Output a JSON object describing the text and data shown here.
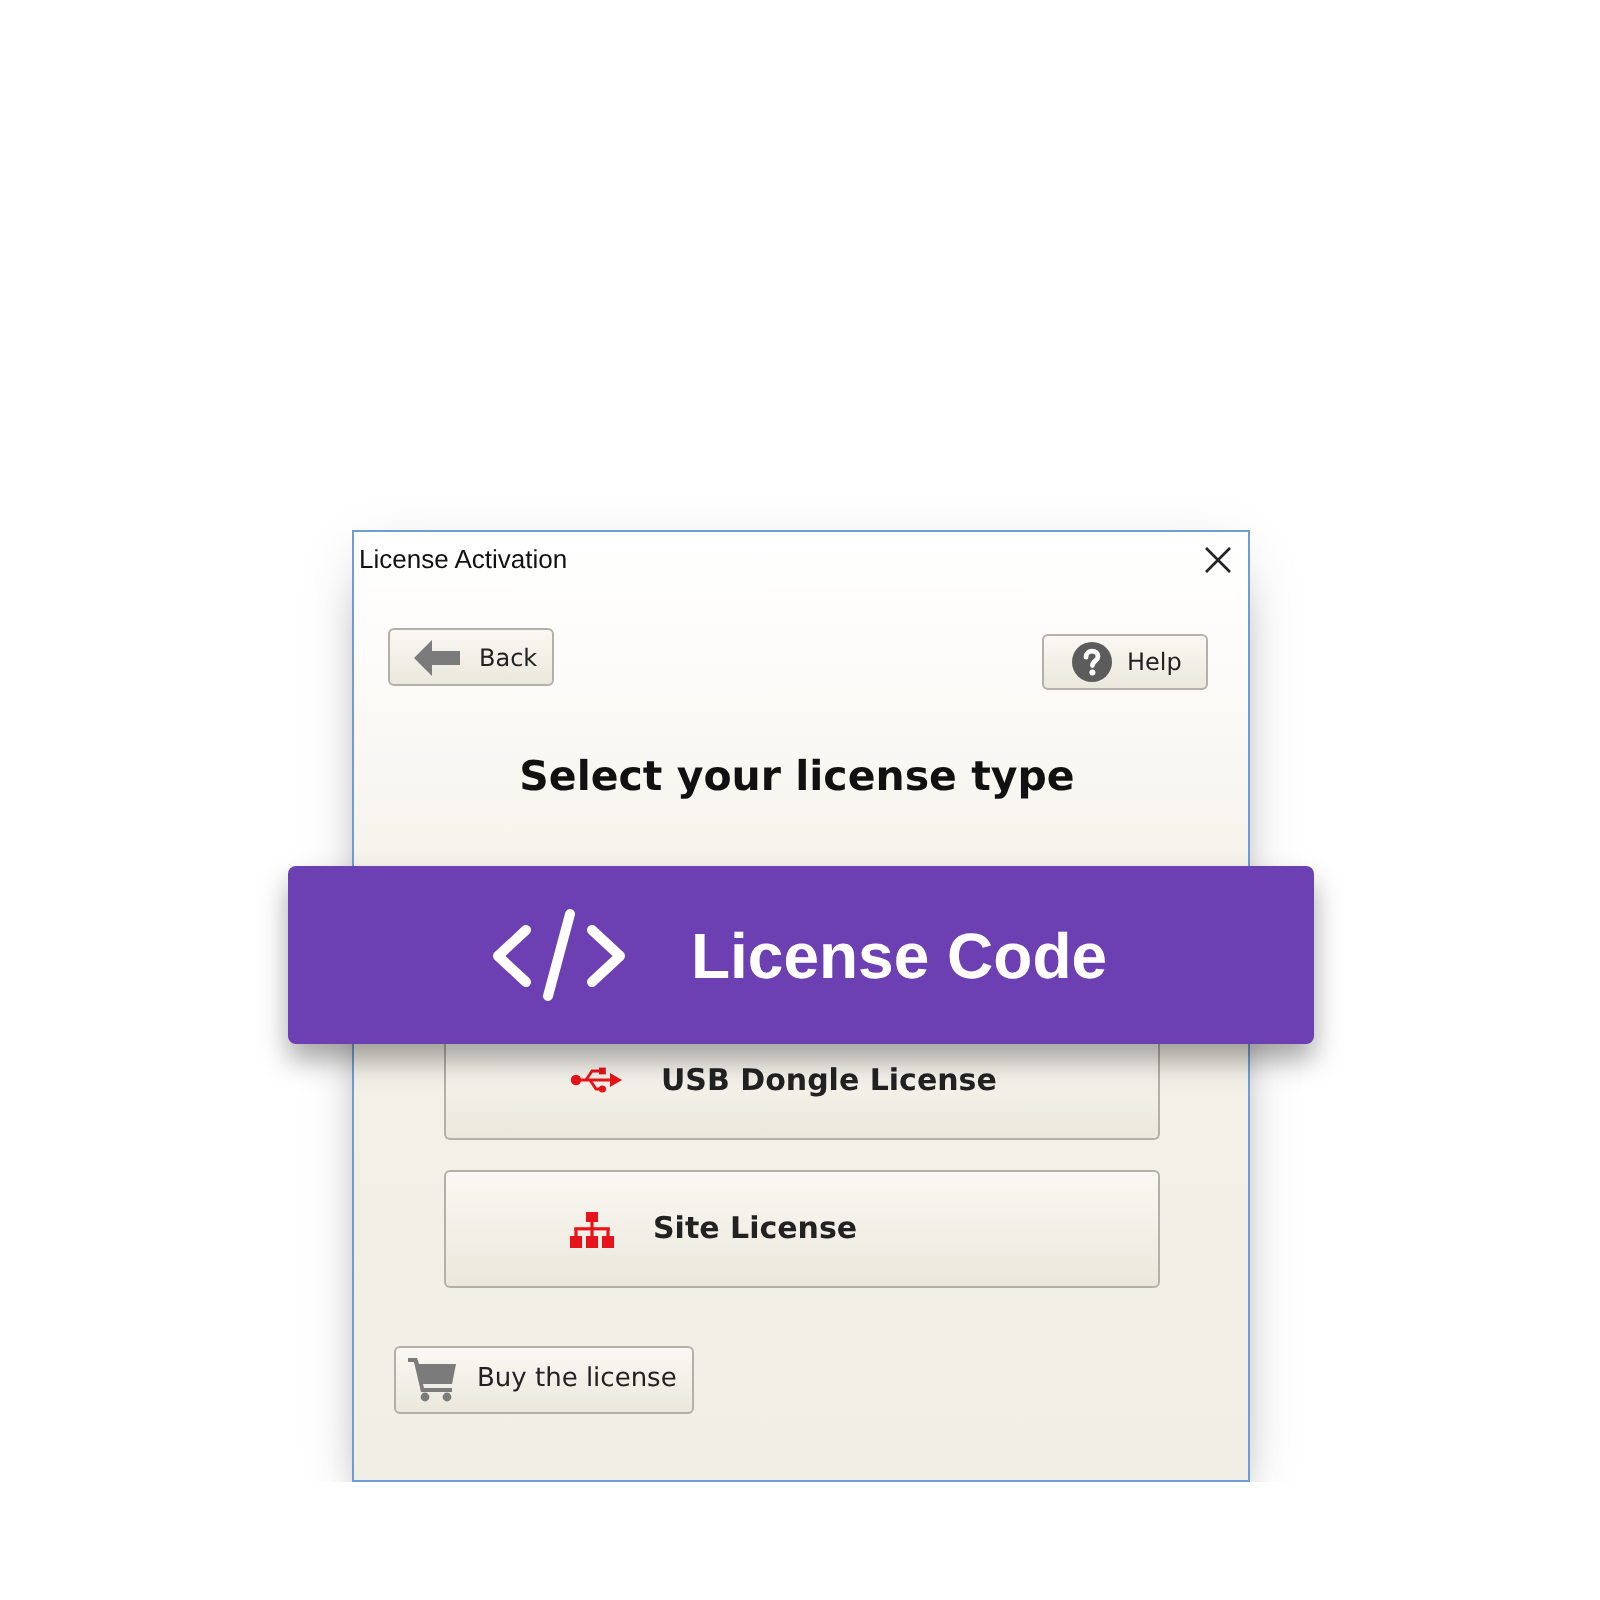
{
  "window": {
    "title": "License Activation"
  },
  "nav_buttons": [
    {
      "kind": "back",
      "label": "Back"
    },
    {
      "kind": "help",
      "label": "Help"
    }
  ],
  "heading": "Select your license type",
  "highlight": {
    "label": "License Code"
  },
  "options": [
    {
      "kind": "usb",
      "label": "USB Dongle License"
    },
    {
      "kind": "site",
      "label": "Site License"
    }
  ],
  "buy_button": {
    "label": "Buy the license"
  }
}
